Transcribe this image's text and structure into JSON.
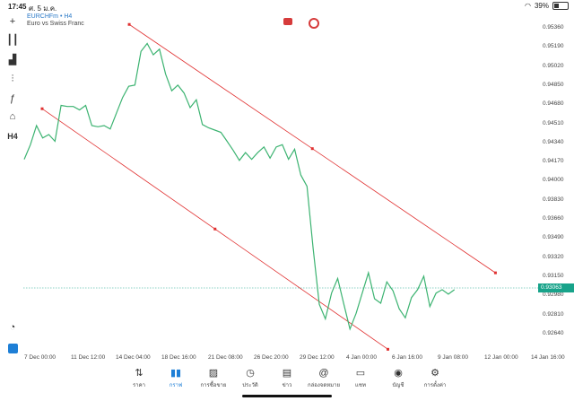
{
  "status_bar": {
    "time": "17:45",
    "date": "ศ. 5 ม.ค.",
    "wifi_icon": "wifi-icon",
    "battery": "39%",
    "battery_level": 0.39
  },
  "header": {
    "symbol": "EURCHFm • H4",
    "description": "Euro vs Swiss Franc"
  },
  "toolbar": {
    "timeframe": "H4"
  },
  "price_axis": [
    "0.95360",
    "0.95190",
    "0.95020",
    "0.94850",
    "0.94680",
    "0.94510",
    "0.94340",
    "0.94170",
    "0.94000",
    "0.93830",
    "0.93660",
    "0.93490",
    "0.93320",
    "0.93150",
    "0.92980",
    "0.92810",
    "0.92640"
  ],
  "current_price": "0.93063",
  "time_axis": [
    "7 Dec 00:00",
    "11 Dec 12:00",
    "14 Dec 04:00",
    "18 Dec 16:00",
    "21 Dec 08:00",
    "26 Dec 20:00",
    "29 Dec 12:00",
    "4 Jan 00:00",
    "6 Jan 16:00",
    "9 Jan 08:00",
    "12 Jan 00:00",
    "14 Jan 16:00"
  ],
  "colors": {
    "line": "#3cb371",
    "channel": "#e03030",
    "price_tag": "#18a38a",
    "active_tab": "#1e7fd6"
  },
  "chart_data": {
    "type": "line",
    "series": [
      {
        "values": [
          0.9419,
          0.9432,
          0.9449,
          0.9438,
          0.9441,
          0.9435,
          0.9467,
          0.9466,
          0.9466,
          0.9463,
          0.9467,
          0.9449,
          0.9448,
          0.9449,
          0.9446,
          0.946,
          0.9474,
          0.9484,
          0.9485,
          0.9515,
          0.9522,
          0.9512,
          0.9517,
          0.9495,
          0.948,
          0.9485,
          0.9478,
          0.9465,
          0.9472,
          0.945,
          0.9447,
          0.9445,
          0.9443,
          0.9435,
          0.9427,
          0.9418,
          0.9425,
          0.9419,
          0.9425,
          0.943,
          0.942,
          0.943,
          0.9432,
          0.9419,
          0.9428,
          0.9405,
          0.9395,
          0.934,
          0.929,
          0.9277,
          0.93,
          0.9313,
          0.929,
          0.9268,
          0.9282,
          0.93,
          0.9318,
          0.9295,
          0.9291,
          0.931,
          0.9302,
          0.9286,
          0.9278,
          0.9296,
          0.9303,
          0.9315,
          0.9288,
          0.93,
          0.9303,
          0.9299,
          0.9303
        ]
      }
    ],
    "x_range": [
      "7 Dec 00:00",
      "4 Jan 00:00"
    ],
    "ylim": [
      0.9257,
      0.9543
    ],
    "channel_lines": [
      {
        "start": [
          "8 Dec 04:00",
          0.9464
        ],
        "end": [
          "30 Dec 16:00",
          0.925
        ]
      },
      {
        "start": [
          "13 Dec 20:00",
          0.9539
        ],
        "end": [
          "6 Jan 16:00",
          0.9318
        ]
      }
    ],
    "grid": false
  },
  "tabs": [
    {
      "label": "ราคา",
      "icon": "quotes-icon"
    },
    {
      "label": "กราฟ",
      "icon": "chart-icon",
      "active": true
    },
    {
      "label": "การซื้อขาย",
      "icon": "trade-icon"
    },
    {
      "label": "ประวัติ",
      "icon": "history-icon"
    },
    {
      "label": "ข่าว",
      "icon": "news-icon"
    },
    {
      "label": "กล่องจดหมาย",
      "icon": "mailbox-icon"
    },
    {
      "label": "แชท",
      "icon": "chat-icon"
    },
    {
      "label": "บัญชี",
      "icon": "account-icon"
    },
    {
      "label": "การตั้งค่า",
      "icon": "settings-icon"
    }
  ]
}
